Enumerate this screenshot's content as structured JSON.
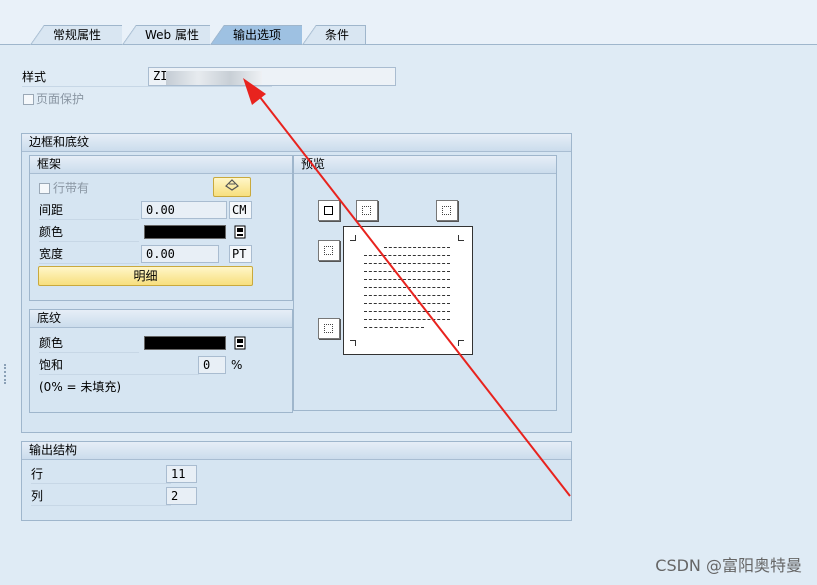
{
  "tabs": [
    {
      "label": "常规属性",
      "active": false
    },
    {
      "label": "Web 属性",
      "active": false
    },
    {
      "label": "输出选项",
      "active": true
    },
    {
      "label": "条件",
      "active": false
    }
  ],
  "style": {
    "label": "样式",
    "value": "ZI                      D"
  },
  "page_protect": {
    "label": "页面保护",
    "checked": false
  },
  "borders": {
    "title": "边框和底纹",
    "frame": {
      "title": "框架",
      "row_has": {
        "label": "行带有",
        "checked": false
      },
      "spacing": {
        "label": "间距",
        "value": "0.00",
        "unit": "CM"
      },
      "color": {
        "label": "颜色",
        "value": "#000000"
      },
      "width": {
        "label": "宽度",
        "value": "0.00",
        "unit": "PT"
      },
      "detail_button": "明细"
    },
    "shading": {
      "title": "底纹",
      "color": {
        "label": "颜色",
        "value": "#000000"
      },
      "saturation": {
        "label": "饱和",
        "value": "0",
        "unit": "%"
      },
      "note": "(0% = 未填充)"
    },
    "preview": {
      "title": "预览"
    }
  },
  "output_structure": {
    "title": "输出结构",
    "rows": {
      "label": "行",
      "value": "11"
    },
    "cols": {
      "label": "列",
      "value": "2"
    }
  },
  "annotation": {
    "color": "#e8231e"
  },
  "watermark": "CSDN @富阳奥特曼",
  "icons": [
    "wand-icon",
    "color-picker-icon",
    "border-top-left-icon",
    "border-top-icon",
    "border-top-right-icon",
    "border-left-icon",
    "border-bottom-left-icon"
  ]
}
